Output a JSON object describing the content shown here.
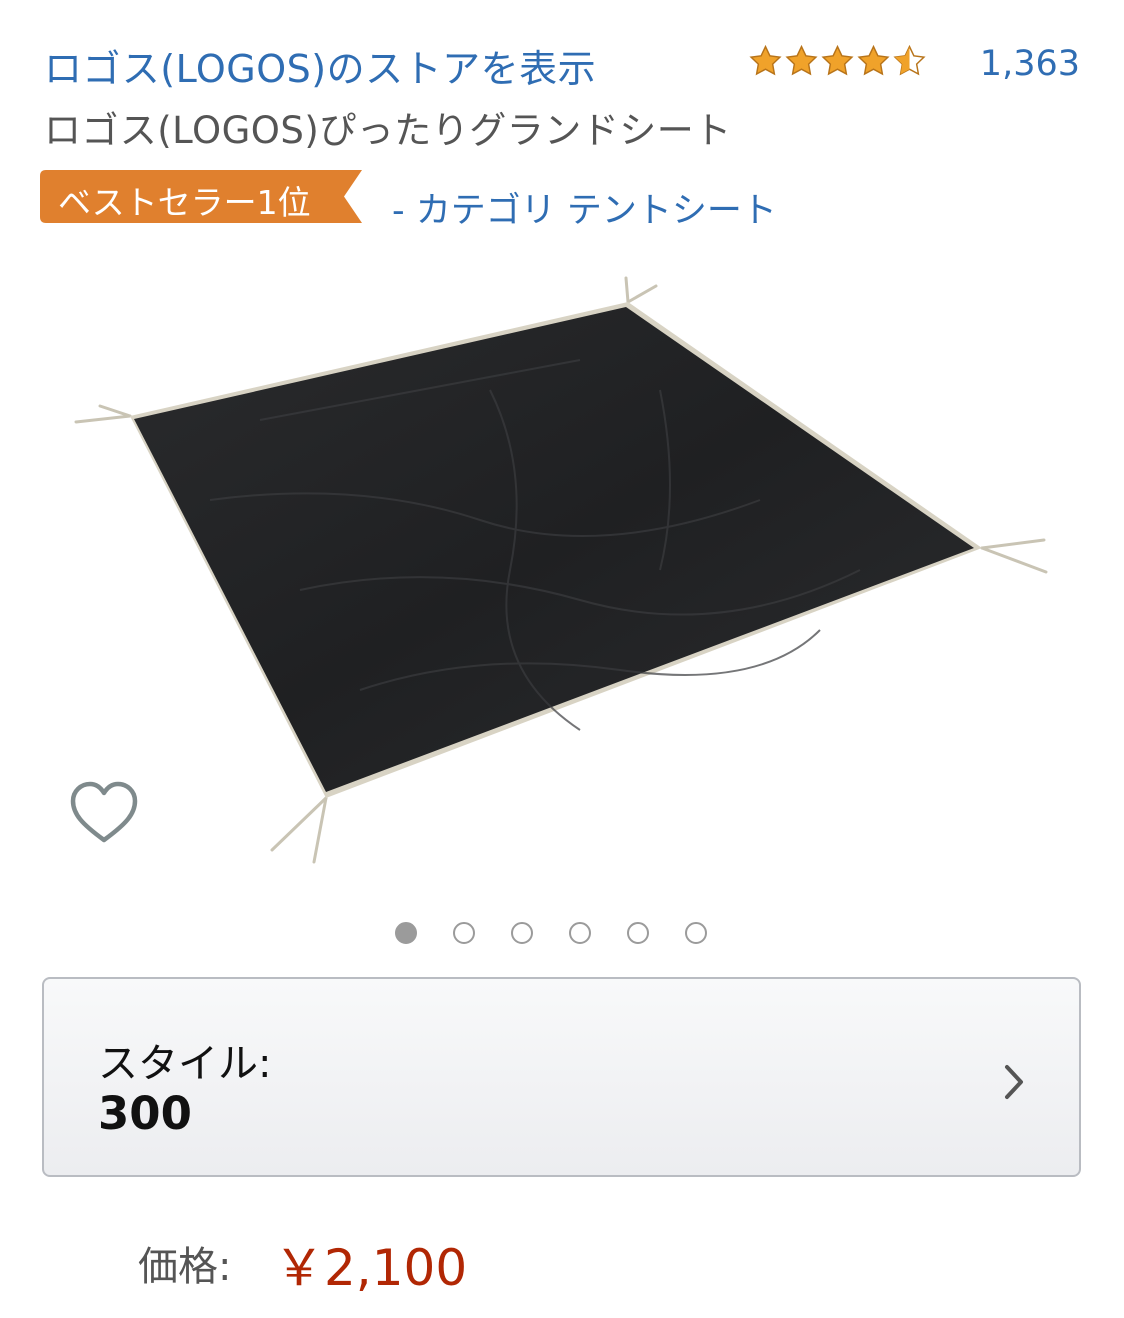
{
  "header": {
    "store_link": "ロゴス(LOGOS)のストアを表示",
    "rating_stars": 4.5,
    "review_count": "1,363"
  },
  "product": {
    "title": "ロゴス(LOGOS)ぴったりグランドシート",
    "bestseller_badge": "ベストセラー1位",
    "category_link": "- カテゴリ テントシート",
    "image_count": 6,
    "active_image_index": 0
  },
  "variant": {
    "label": "スタイル:",
    "value": "300"
  },
  "price": {
    "label": "価格:",
    "value": "￥2,100"
  },
  "colors": {
    "link": "#2f6db3",
    "badge": "#e0802e",
    "star": "#f0a22a",
    "price": "#b12704"
  },
  "icons": [
    "star-icon",
    "heart-icon",
    "chevron-right-icon"
  ]
}
